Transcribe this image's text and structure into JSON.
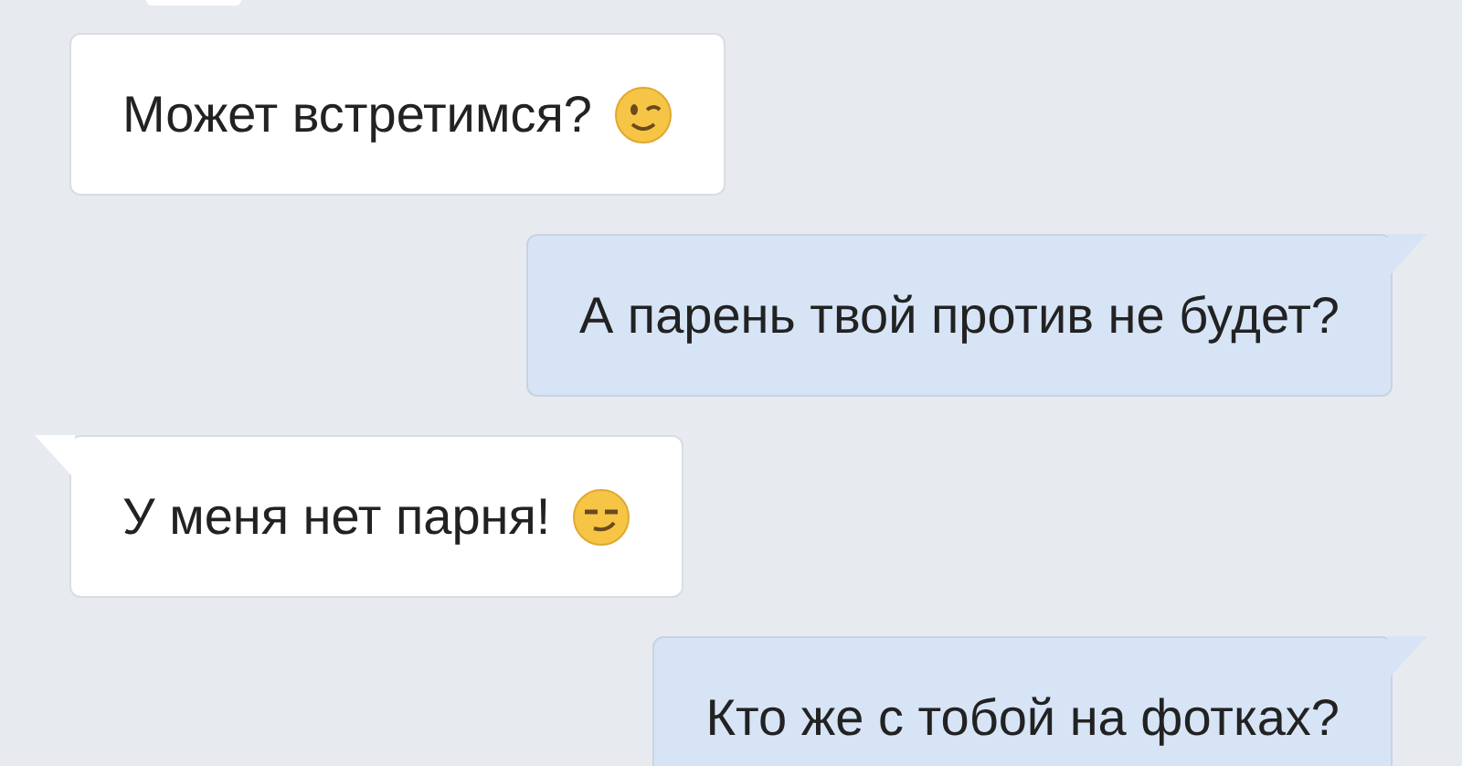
{
  "messages": [
    {
      "kind": "partial"
    },
    {
      "kind": "incoming",
      "tail": false,
      "text": "Может встретимся?",
      "emoji": {
        "kind": "wink"
      }
    },
    {
      "kind": "outgoing",
      "tail": true,
      "text": "А парень твой против не будет?"
    },
    {
      "kind": "incoming",
      "tail": true,
      "text": "У меня нет парня!",
      "emoji": {
        "kind": "smirk"
      }
    },
    {
      "kind": "outgoing",
      "tail": true,
      "text": "Кто же с тобой на фотках?"
    }
  ]
}
